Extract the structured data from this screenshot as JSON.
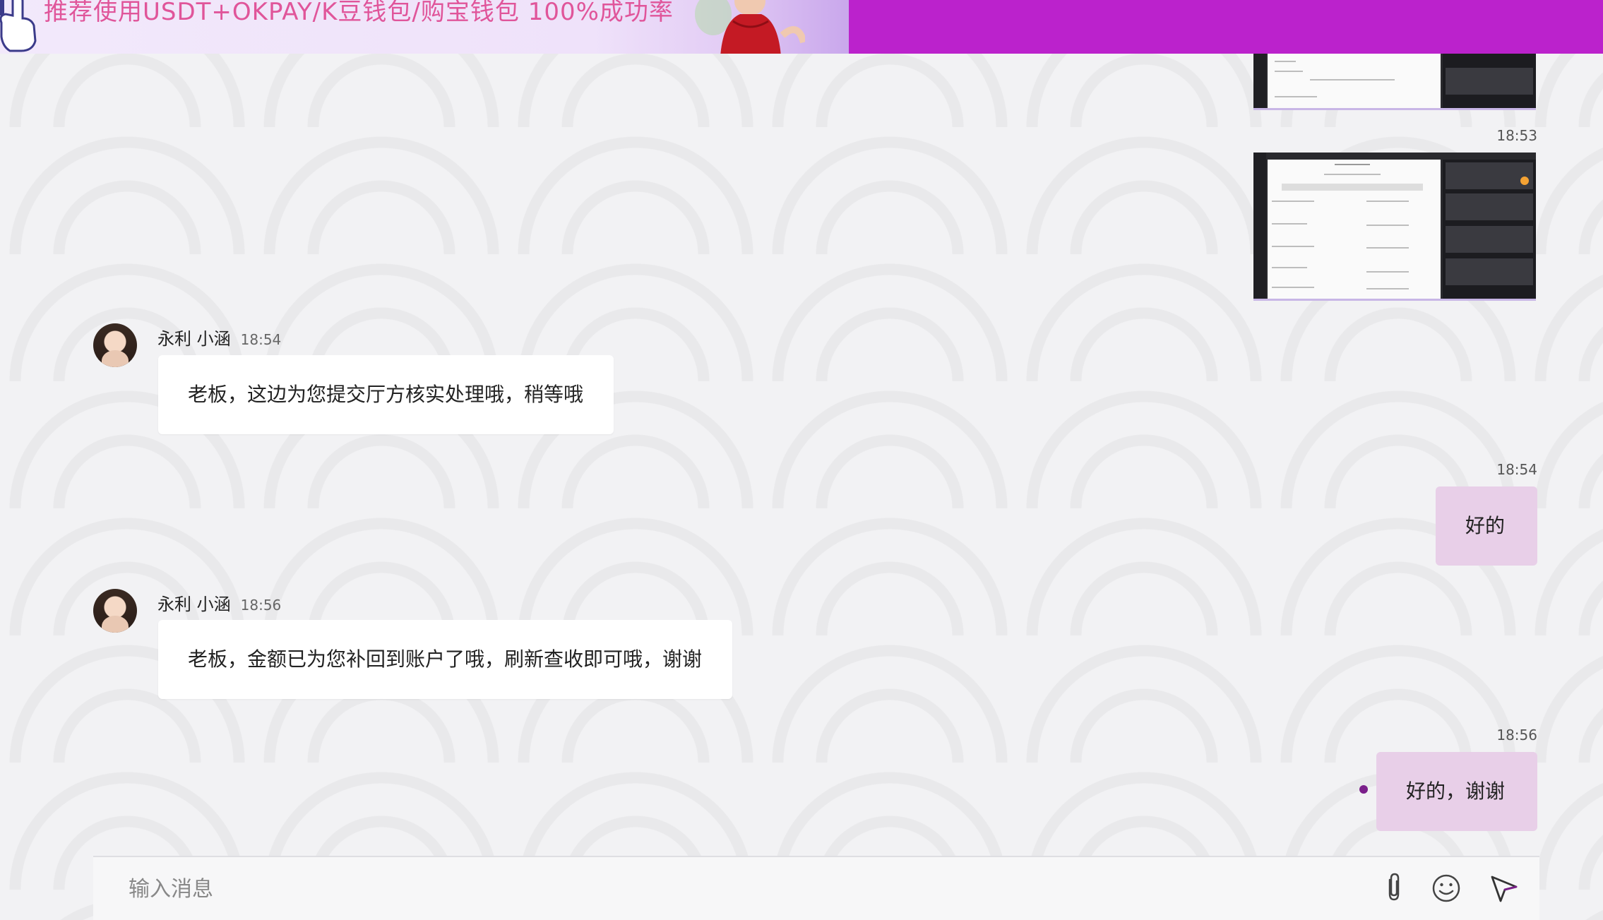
{
  "banner": {
    "text": "推荐使用USDT+OKPAY/K豆钱包/购宝钱包  100%成功率"
  },
  "messages": {
    "shot2_time": "18:53",
    "msg1": {
      "sender": "永利 小涵",
      "time": "18:54",
      "text": "老板，这边为您提交厅方核实处理哦，稍等哦"
    },
    "reply1": {
      "time": "18:54",
      "text": "好的"
    },
    "msg2": {
      "sender": "永利 小涵",
      "time": "18:56",
      "text": "老板，金额已为您补回到账户了哦，刷新查收即可哦，谢谢"
    },
    "reply2": {
      "time": "18:56",
      "text": "好的，谢谢"
    }
  },
  "composer": {
    "placeholder": "输入消息",
    "icons": [
      "paperclip-icon",
      "emoji-icon",
      "send-icon"
    ]
  },
  "colors": {
    "banner_bg": "#bb22cc",
    "outgoing_bubble": "#e8cfe8",
    "incoming_bubble": "#ffffff",
    "read_dot": "#7a1f8a"
  }
}
